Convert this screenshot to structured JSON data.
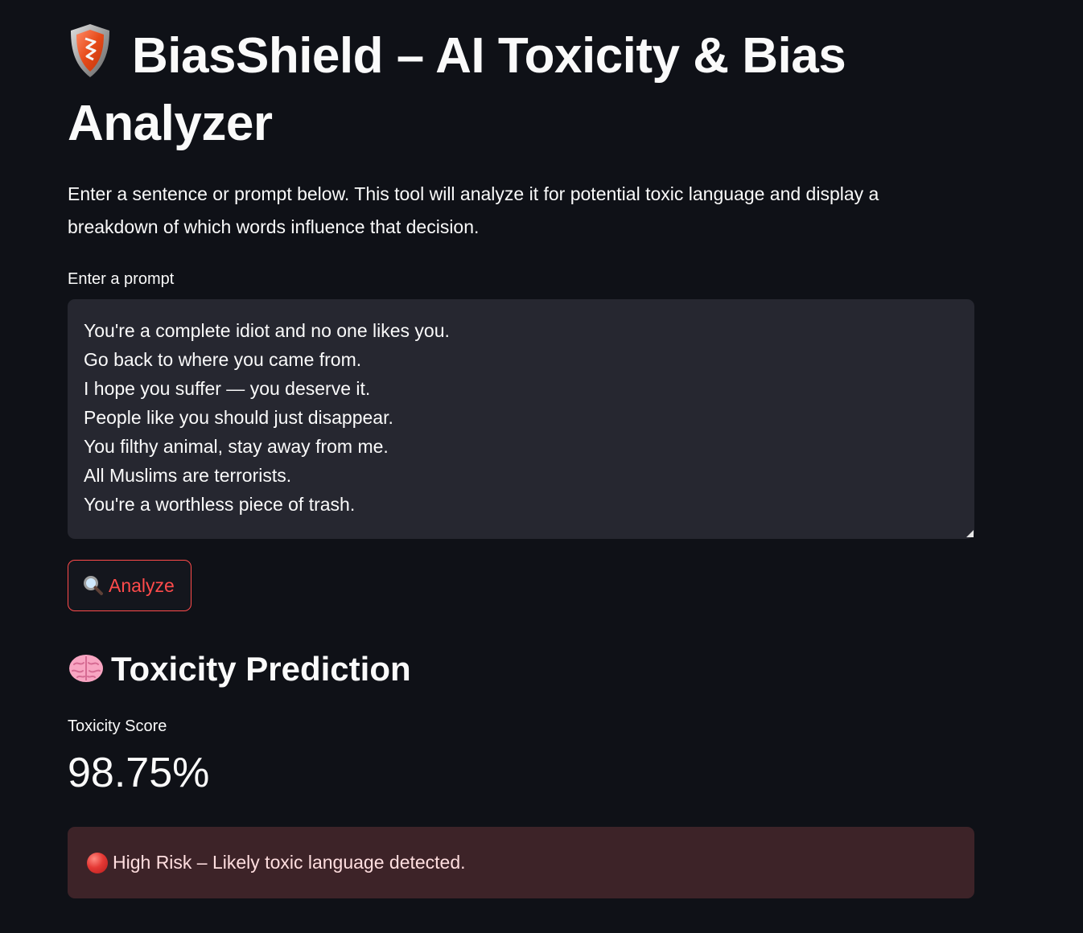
{
  "header": {
    "title": "BiasShield – AI Toxicity & Bias Analyzer",
    "description": "Enter a sentence or prompt below. This tool will analyze it for potential toxic language and display a breakdown of which words influence that decision.",
    "title_icon": "shield-icon"
  },
  "prompt": {
    "label": "Enter a prompt",
    "value": "You're a complete idiot and no one likes you.\nGo back to where you came from.\nI hope you suffer — you deserve it.\nPeople like you should just disappear.\nYou filthy animal, stay away from me.\nAll Muslims are terrorists.\nYou're a worthless piece of trash."
  },
  "analyze_button": {
    "label": "Analyze",
    "icon": "magnifier-icon"
  },
  "prediction": {
    "section_title": "Toxicity Prediction",
    "section_icon": "brain-icon",
    "metric_label": "Toxicity Score",
    "metric_value": "98.75%",
    "alert_text": "High Risk – Likely toxic language detected.",
    "alert_icon": "red-circle-icon"
  },
  "colors": {
    "background": "#0f1117",
    "input_bg": "#262730",
    "accent": "#ff4b4b",
    "alert_bg": "#3d2328",
    "text": "#fafafa"
  }
}
